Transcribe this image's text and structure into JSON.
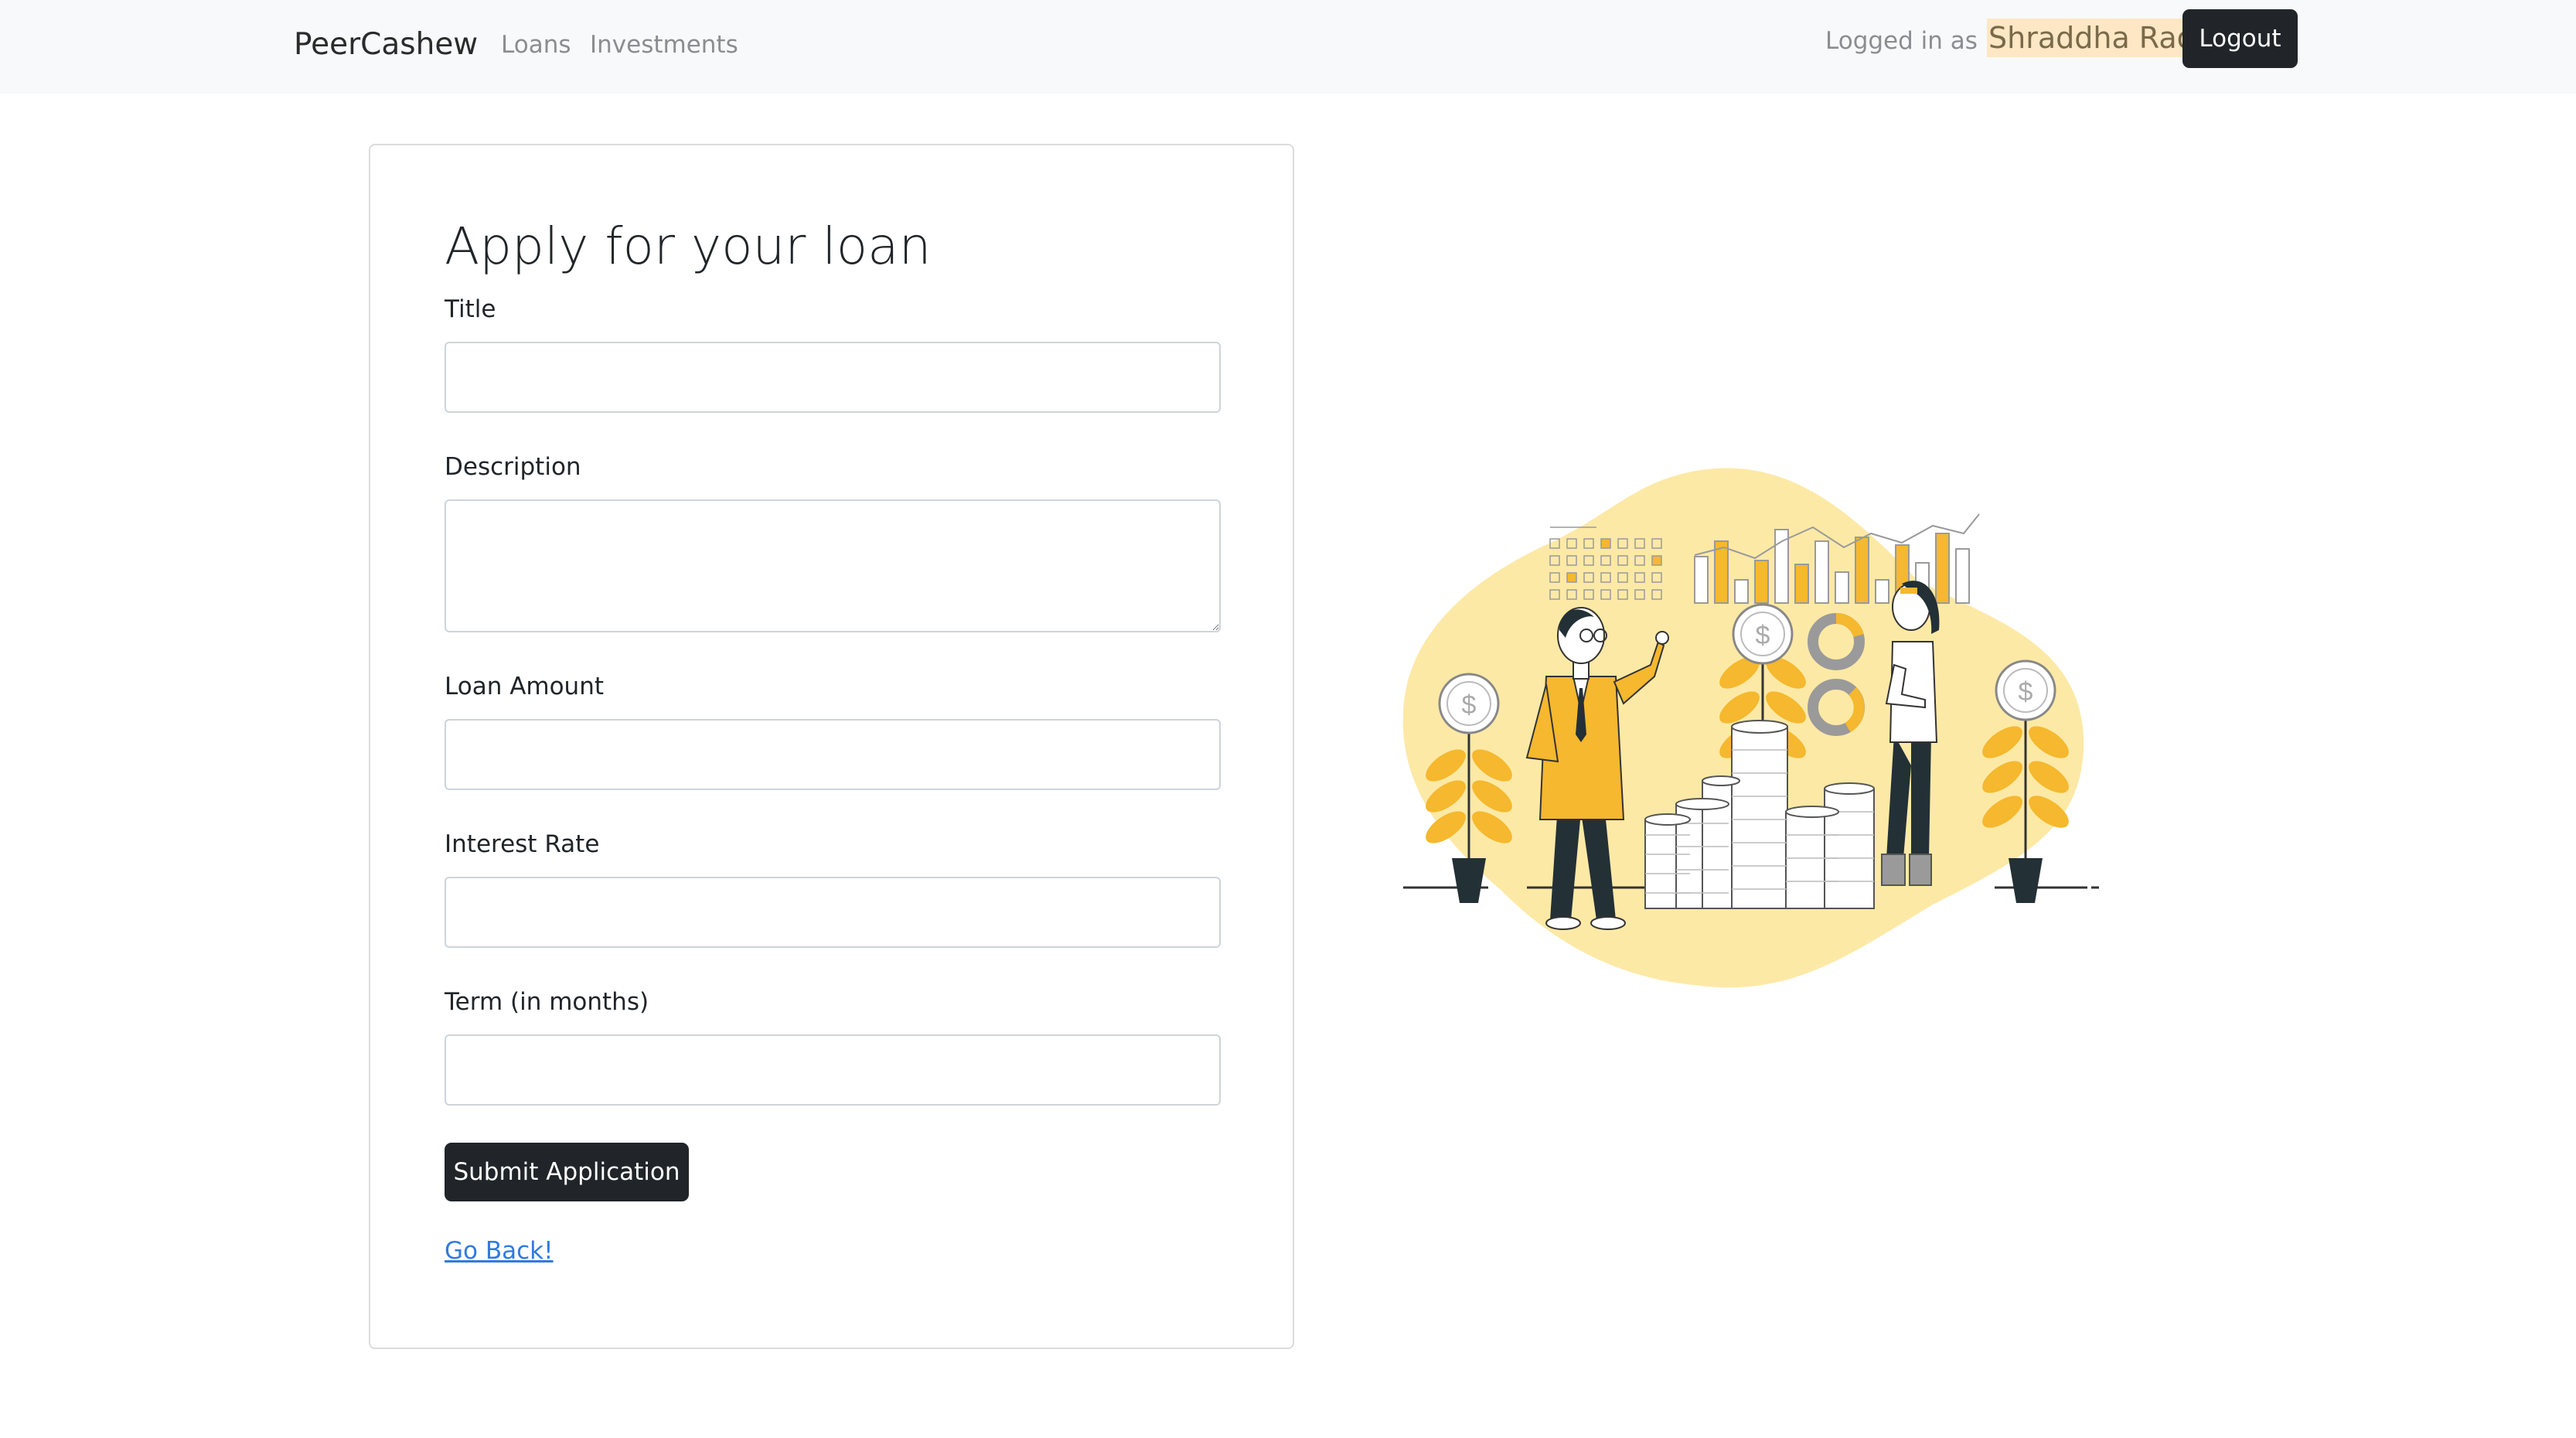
{
  "navbar": {
    "brand": "PeerCashew",
    "links": [
      {
        "label": "Loans"
      },
      {
        "label": "Investments"
      }
    ],
    "logged_in_label": "Logged in as",
    "user_name": "Shraddha Rao",
    "logout_label": "Logout"
  },
  "form": {
    "title": "Apply for your loan",
    "fields": [
      {
        "label": "Title",
        "value": ""
      },
      {
        "label": "Description",
        "value": ""
      },
      {
        "label": "Loan Amount",
        "value": ""
      },
      {
        "label": "Interest Rate",
        "value": ""
      },
      {
        "label": "Term (in months)",
        "value": ""
      }
    ],
    "submit_label": "Submit Application",
    "back_link": "Go Back!"
  },
  "colors": {
    "accent": "#f5b82e",
    "blob": "#fde9a6",
    "dark_button": "#212529",
    "link": "#2f7be0",
    "user_highlight": "#fde7c4"
  },
  "illustration": {
    "icon": "finance-investment-illustration"
  }
}
